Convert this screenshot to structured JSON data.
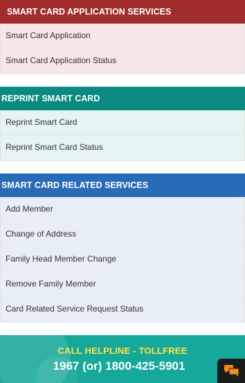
{
  "panels": [
    {
      "title": "SMART CARD APPLICATION SERVICES",
      "items": [
        "Smart Card Application",
        "Smart Card Application Status"
      ]
    },
    {
      "title": "REPRINT SMART CARD",
      "items": [
        "Reprint Smart Card",
        "Reprint Smart Card Status"
      ]
    },
    {
      "title": "SMART CARD RELATED SERVICES",
      "items": [
        "Add Member",
        "Change of Address",
        "Family Head Member Change",
        "Remove Family Member",
        "Card Related Service Request Status"
      ]
    }
  ],
  "helpline": {
    "label": "CALL HELPLINE - TOLLFREE",
    "number": "1967 (or) 1800-425-5901"
  },
  "chat": {
    "icon": "chat-bubbles-icon"
  },
  "colors": {
    "application_header": "#a02c2c",
    "reprint_header": "#0a8a80",
    "related_header": "#2a6bb9",
    "helpline_bg": "#16a89a",
    "helpline_label": "#ffe34d"
  }
}
